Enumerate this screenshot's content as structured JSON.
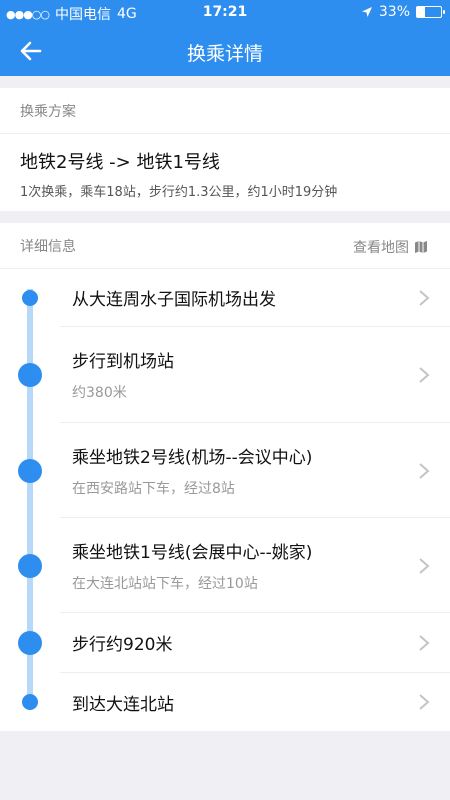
{
  "status": {
    "carrier": "中国电信",
    "network": "4G",
    "time": "17:21",
    "battery_text": "33%",
    "battery_level": 0.33,
    "signal_dots": "●●●○○"
  },
  "nav": {
    "title": "换乘详情"
  },
  "plan_section": {
    "header": "换乘方案",
    "title": "地铁2号线 -> 地铁1号线",
    "desc": "1次换乘，乘车18站，步行约1.3公里，约1小时19分钟"
  },
  "detail_section": {
    "header": "详细信息",
    "map_link": "查看地图"
  },
  "steps": [
    {
      "title": "从大连周水子国际机场出发",
      "sub": ""
    },
    {
      "title": "步行到机场站",
      "sub": "约380米"
    },
    {
      "title": "乘坐地铁2号线(机场--会议中心)",
      "sub": "在西安路站下车，经过8站"
    },
    {
      "title": "乘坐地铁1号线(会展中心--姚家)",
      "sub": "在大连北站站下车，经过10站"
    },
    {
      "title": "步行约920米",
      "sub": ""
    },
    {
      "title": "到达大连北站",
      "sub": ""
    }
  ],
  "colors": {
    "primary": "#2d8ef0",
    "track": "#b7d8f8"
  }
}
